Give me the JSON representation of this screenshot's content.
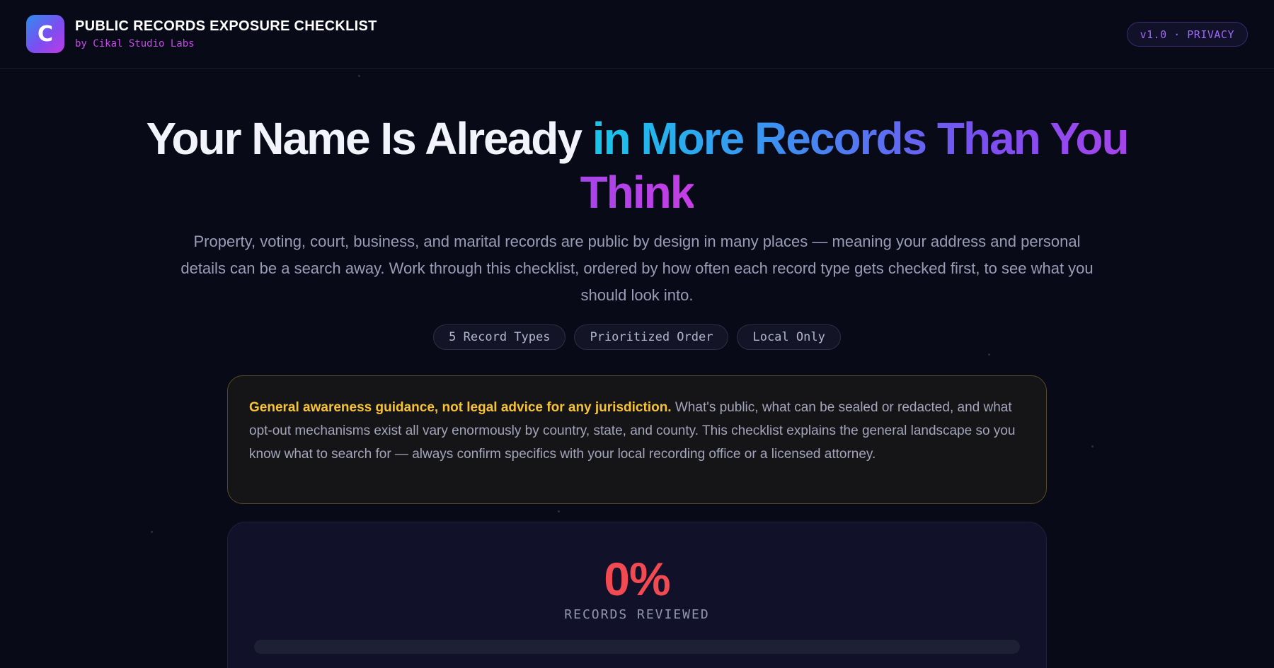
{
  "header": {
    "logo_letter": "C",
    "title": "PUBLIC RECORDS EXPOSURE CHECKLIST",
    "subtitle": "by Cikal Studio Labs",
    "version_badge": "v1.0 · PRIVACY"
  },
  "hero": {
    "title_plain": "Your Name Is Already ",
    "title_gradient": "in More Records Than You Think",
    "description": "Property, voting, court, business, and marital records are public by design in many places — meaning your address and personal details can be a search away. Work through this checklist, ordered by how often each record type gets checked first, to see what you should look into.",
    "tags": [
      "5 Record Types",
      "Prioritized Order",
      "Local Only"
    ]
  },
  "disclaimer": {
    "bold_text": "General awareness guidance, not legal advice for any jurisdiction.",
    "body_text": " What's public, what can be sealed or redacted, and what opt-out mechanisms exist all vary enormously by country, state, and county. This checklist explains the general landscape so you know what to search for — always confirm specifics with your local recording office or a licensed attorney."
  },
  "progress": {
    "percent_text": "0%",
    "label": "RECORDS REVIEWED",
    "fraction": 0
  },
  "colors": {
    "background": "#090a17",
    "accent_red": "#f24a52",
    "warning_yellow": "#f7c234",
    "brand_magenta": "#c64ae8"
  }
}
